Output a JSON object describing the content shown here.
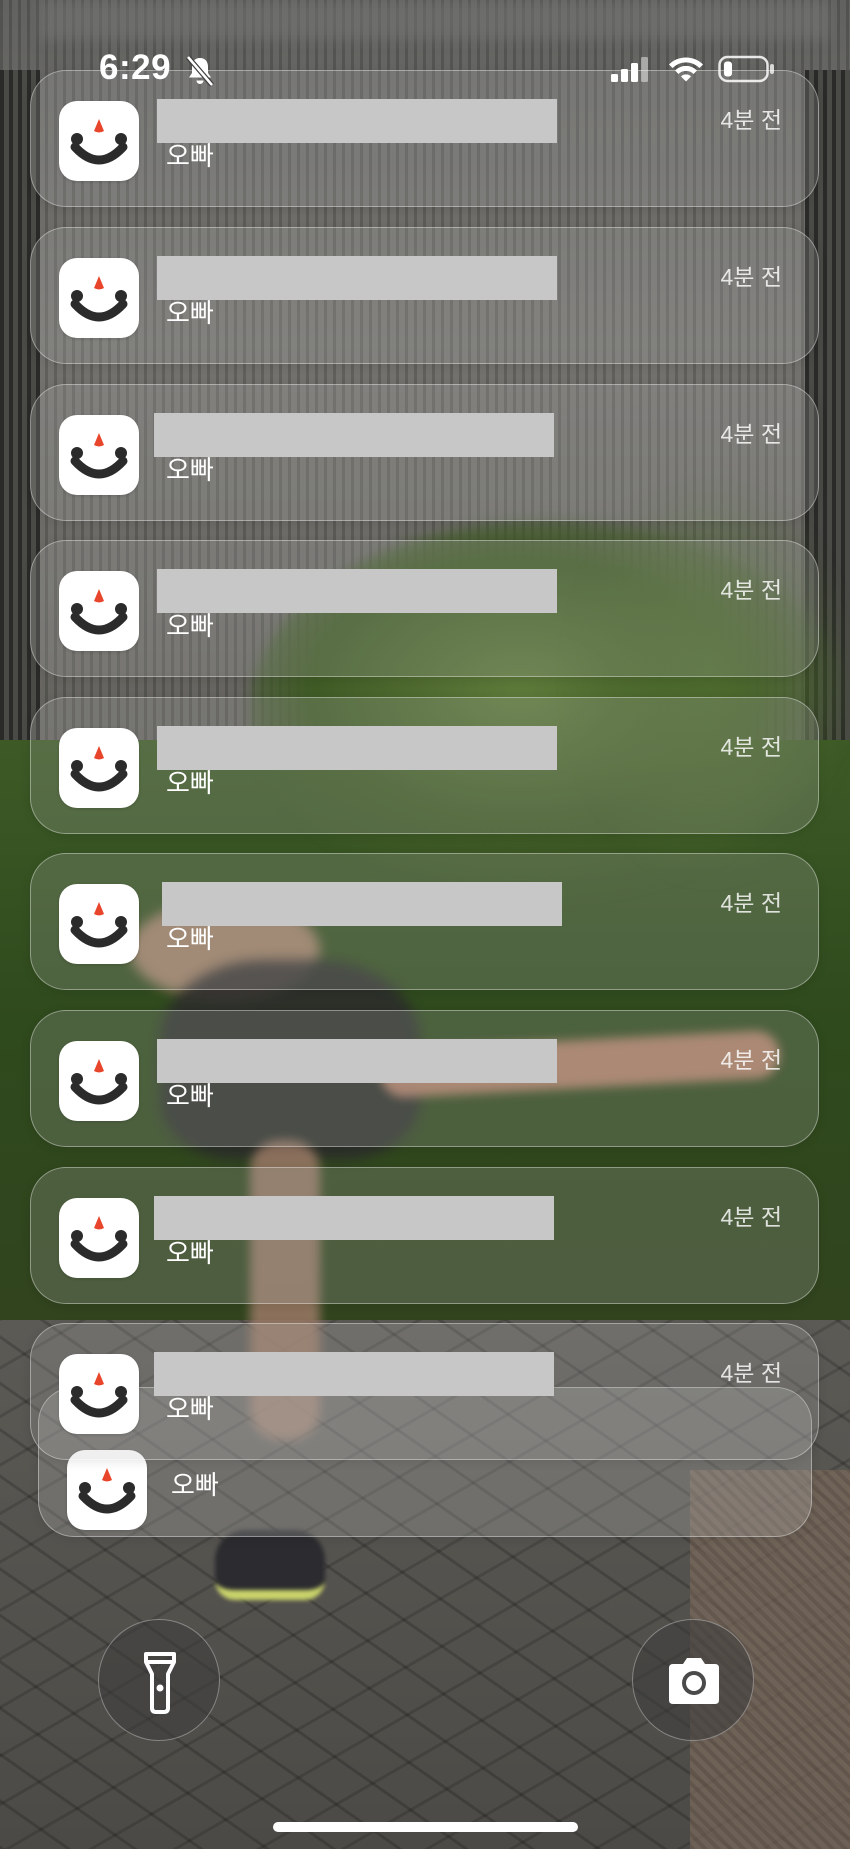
{
  "status_bar": {
    "time": "6:29",
    "icons": [
      "bell-slash-icon",
      "cellular-signal-icon",
      "wifi-icon",
      "battery-icon"
    ]
  },
  "notifications": [
    {
      "icon": "app-smile-icon",
      "title_redacted": true,
      "body": "오빠",
      "timestamp": "4분 전"
    },
    {
      "icon": "app-smile-icon",
      "title_redacted": true,
      "body": "오빠",
      "timestamp": "4분 전"
    },
    {
      "icon": "app-smile-icon",
      "title_redacted": true,
      "body": "오빠",
      "timestamp": "4분 전"
    },
    {
      "icon": "app-smile-icon",
      "title_redacted": true,
      "body": "오빠",
      "timestamp": "4분 전"
    },
    {
      "icon": "app-smile-icon",
      "title_redacted": true,
      "body": "오빠",
      "timestamp": "4분 전"
    },
    {
      "icon": "app-smile-icon",
      "title_redacted": true,
      "body": "오빠",
      "timestamp": "4분 전"
    },
    {
      "icon": "app-smile-icon",
      "title_redacted": true,
      "body": "오빠",
      "timestamp": "4분 전"
    },
    {
      "icon": "app-smile-icon",
      "title_redacted": true,
      "body": "오빠",
      "timestamp": "4분 전"
    },
    {
      "icon": "app-smile-icon",
      "title_redacted": true,
      "body": "오빠",
      "timestamp": "4분 전"
    }
  ],
  "stacked_notification": {
    "icon": "app-smile-icon",
    "body": "오빠"
  },
  "bottom_controls": {
    "left": "flashlight-icon",
    "right": "camera-icon"
  },
  "colors": {
    "icon_background": "#ffffff",
    "logo_dark": "#2b2b2b",
    "logo_accent": "#e8462c",
    "redaction": "#c7c7c7"
  }
}
